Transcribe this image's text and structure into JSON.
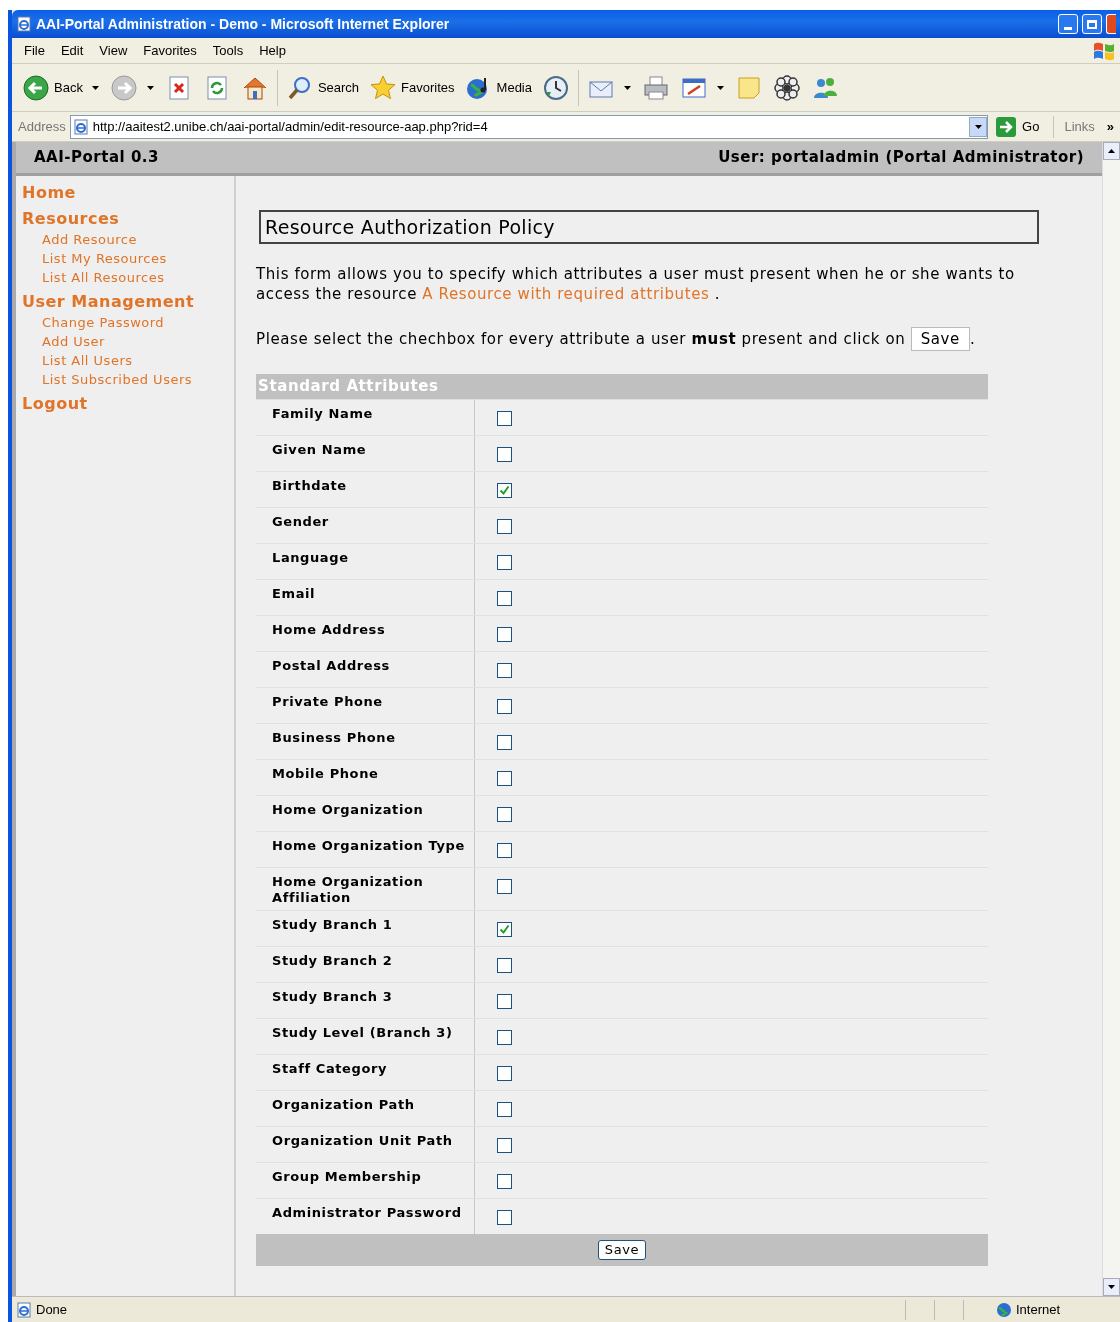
{
  "window": {
    "title": "AAI-Portal Administration - Demo - Microsoft Internet Explorer"
  },
  "menu": [
    "File",
    "Edit",
    "View",
    "Favorites",
    "Tools",
    "Help"
  ],
  "toolbar": [
    {
      "kind": "back",
      "label": "Back",
      "dropdown": true
    },
    {
      "kind": "forward",
      "dropdown": true
    },
    {
      "kind": "stop"
    },
    {
      "kind": "refresh"
    },
    {
      "kind": "home"
    },
    {
      "kind": "search",
      "label": "Search"
    },
    {
      "kind": "favorites",
      "label": "Favorites"
    },
    {
      "kind": "media",
      "label": "Media"
    },
    {
      "kind": "history"
    },
    {
      "kind": "mail",
      "dropdown": true
    },
    {
      "kind": "print"
    },
    {
      "kind": "edit",
      "dropdown": true
    },
    {
      "kind": "note"
    },
    {
      "kind": "flower"
    },
    {
      "kind": "people"
    }
  ],
  "address": {
    "label": "Address",
    "url": "http://aaitest2.unibe.ch/aai-portal/admin/edit-resource-aap.php?rid=4",
    "go": "Go",
    "links": "Links",
    "more": "»"
  },
  "header": {
    "app": "AAI-Portal 0.3",
    "user": "User: portaladmin (Portal Administrator)"
  },
  "sidebar": [
    {
      "label": "Home"
    },
    {
      "label": "Resources",
      "children": [
        "Add Resource",
        "List My Resources",
        "List All Resources"
      ]
    },
    {
      "label": "User Management",
      "children": [
        "Change Password",
        "Add User",
        "List All Users",
        "List Subscribed Users"
      ]
    },
    {
      "label": "Logout"
    }
  ],
  "heading": "Resource Authorization Policy",
  "intro": {
    "text": "This form allows you to specify which attributes a user must present when he or she wants to access the resource",
    "link": "A Resource with required attributes",
    "end": "."
  },
  "instruction": {
    "text": "Please select the chechbox for every attribute a user **must** present and click on",
    "button": "Save",
    "end": "."
  },
  "table": {
    "title": "Standard Attributes",
    "rows": [
      {
        "name": "Family Name",
        "checked": false
      },
      {
        "name": "Given Name",
        "checked": false
      },
      {
        "name": "Birthdate",
        "checked": true
      },
      {
        "name": "Gender",
        "checked": false
      },
      {
        "name": "Language",
        "checked": false
      },
      {
        "name": "Email",
        "checked": false
      },
      {
        "name": "Home Address",
        "checked": false
      },
      {
        "name": "Postal Address",
        "checked": false
      },
      {
        "name": "Private Phone",
        "checked": false
      },
      {
        "name": "Business Phone",
        "checked": false
      },
      {
        "name": "Mobile Phone",
        "checked": false
      },
      {
        "name": "Home Organization",
        "checked": false
      },
      {
        "name": "Home Organization Type",
        "checked": false
      },
      {
        "name": "Home Organization Affiliation",
        "checked": false
      },
      {
        "name": "Study Branch 1",
        "checked": true
      },
      {
        "name": "Study Branch 2",
        "checked": false
      },
      {
        "name": "Study Branch 3",
        "checked": false
      },
      {
        "name": "Study Level (Branch 3)",
        "checked": false
      },
      {
        "name": "Staff Category",
        "checked": false
      },
      {
        "name": "Organization Path",
        "checked": false
      },
      {
        "name": "Organization Unit Path",
        "checked": false
      },
      {
        "name": "Group Membership",
        "checked": false
      },
      {
        "name": "Administrator Password",
        "checked": false
      }
    ],
    "button": "Save"
  },
  "status": {
    "text": "Done",
    "zone": "Internet"
  }
}
